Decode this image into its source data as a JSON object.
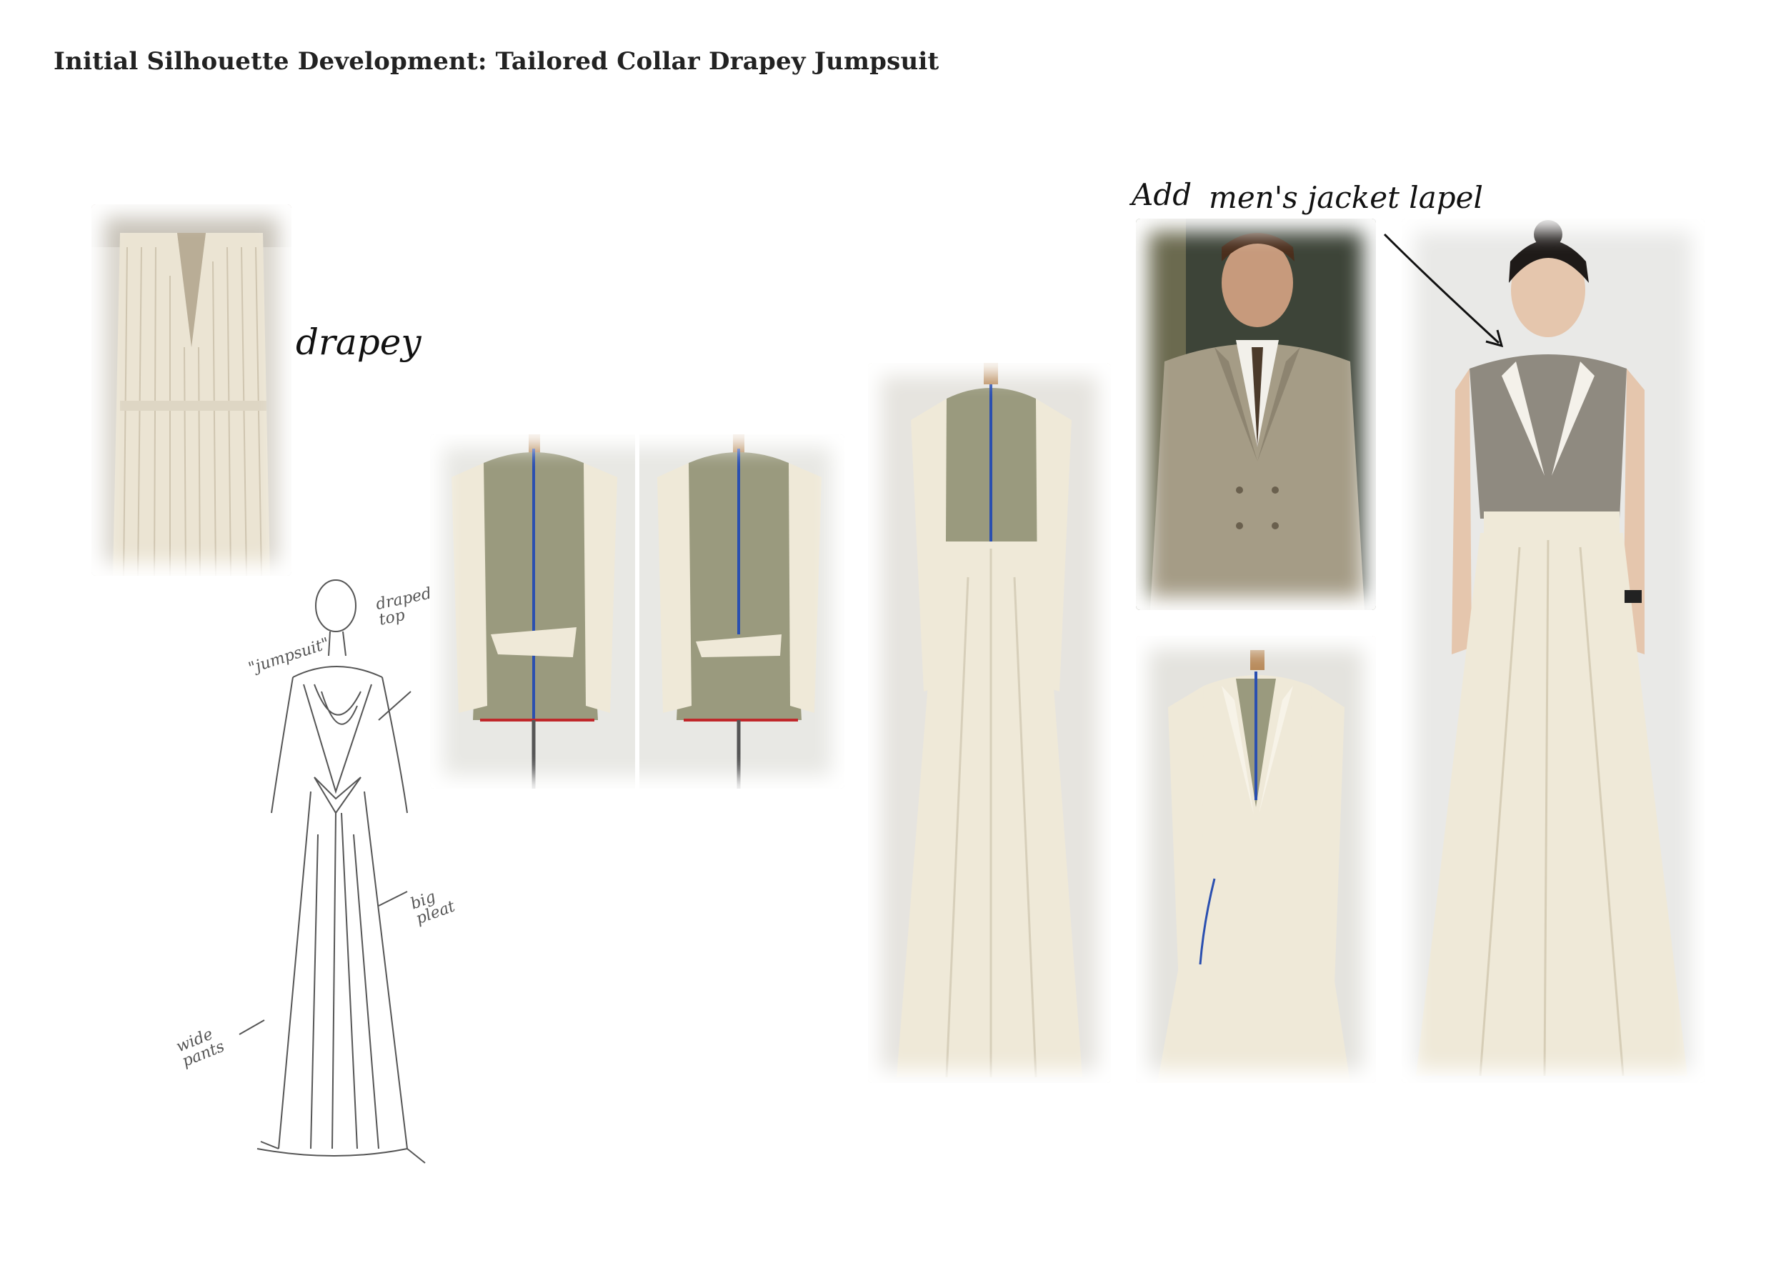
{
  "title": "Initial Silhouette Development: Tailored Collar Drapey Jumpsuit",
  "annotations": {
    "drapey": "drapey",
    "add": "Add",
    "mens_jacket_lapel": "men's jacket lapel"
  },
  "sketch_notes": {
    "jumpsuit": "\"jumpsuit\"",
    "draped_top_line1": "draped",
    "draped_top_line2": "top",
    "big_pleat_line1": "big",
    "big_pleat_line2": "pleat",
    "wide_pants_line1": "wide",
    "wide_pants_line2": "pants"
  },
  "colors": {
    "muslin": "#efe9d8",
    "form": "#9a9a7e",
    "tape_blue": "#2a4fb0",
    "tape_red": "#c0282b",
    "suit": "#a59c86",
    "grey_top": "#8f8a80"
  }
}
